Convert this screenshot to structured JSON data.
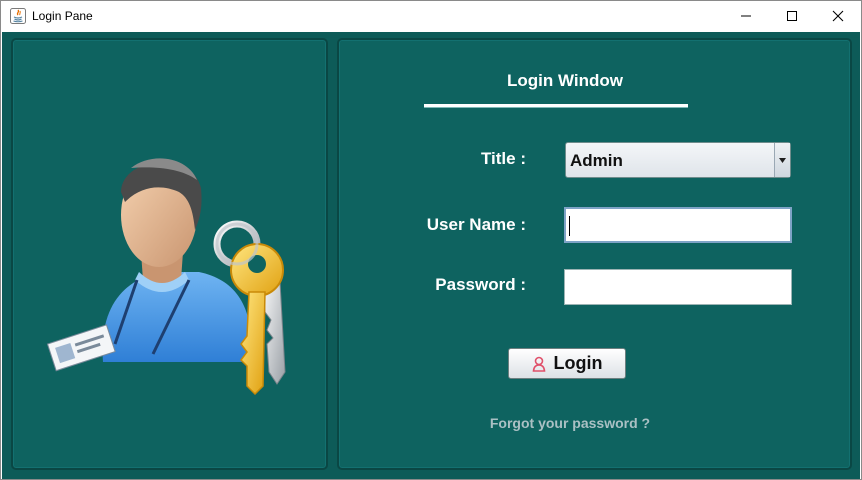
{
  "window": {
    "title": "Login Pane",
    "controls": [
      "minimize-icon",
      "maximize-icon",
      "close-icon"
    ]
  },
  "login": {
    "heading": "Login Window",
    "title_label": "Title :",
    "title_selected": "Admin",
    "username_label": "User Name :",
    "username_value": "",
    "password_label": "Password :",
    "password_value": "",
    "login_button": "Login",
    "forgot_link": "Forgot your password ?"
  },
  "illustration": {
    "icon": "user-with-keys-icon"
  },
  "colors": {
    "background": "#0d5b58",
    "panel": "#0e6360",
    "text": "#ffffff",
    "link": "#aac0c4"
  }
}
